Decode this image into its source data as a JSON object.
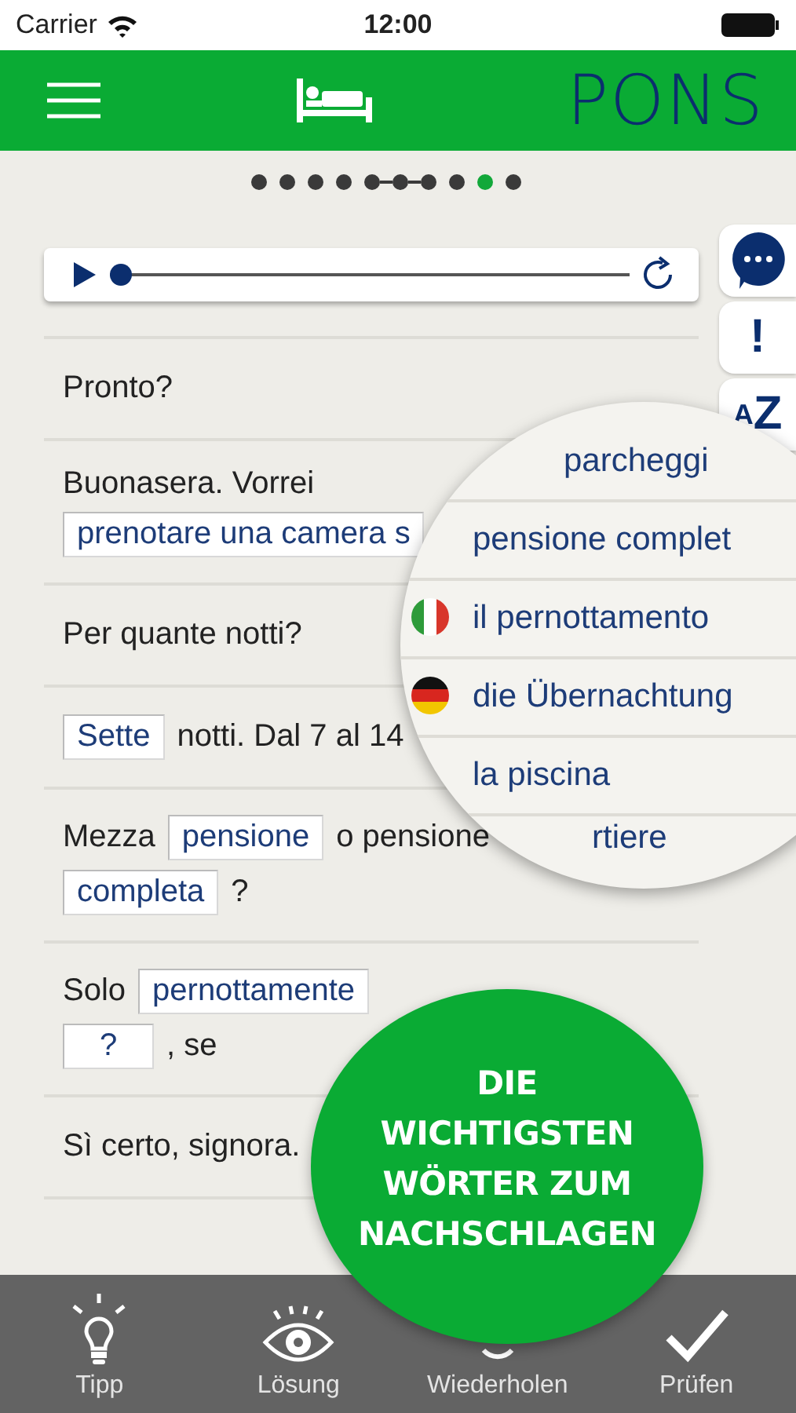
{
  "status_bar": {
    "carrier": "Carrier",
    "time": "12:00"
  },
  "header": {
    "logo": "PONS"
  },
  "page_dots": [
    {
      "selected": false,
      "linked": false
    },
    {
      "selected": false,
      "linked": false
    },
    {
      "selected": false,
      "linked": false
    },
    {
      "selected": false,
      "linked": false
    },
    {
      "selected": false,
      "linked": true
    },
    {
      "selected": false,
      "linked": true
    },
    {
      "selected": false,
      "linked": false
    },
    {
      "selected": false,
      "linked": false
    },
    {
      "selected": true,
      "linked": false
    },
    {
      "selected": false,
      "linked": false
    }
  ],
  "player": {
    "level": 0
  },
  "side_tabs": [
    {
      "kind": "chat"
    },
    {
      "kind": "text",
      "label": "!"
    },
    {
      "kind": "text",
      "label": "$^{A}$Z"
    }
  ],
  "dialogue": [
    {
      "lines": [
        [
          {
            "kind": "text",
            "text": "Pronto?"
          }
        ]
      ]
    },
    {
      "lines": [
        [
          {
            "kind": "text",
            "text": "Buonasera. Vorrei"
          }
        ],
        [
          {
            "kind": "blank",
            "text": "prenotare una camera s"
          }
        ]
      ]
    },
    {
      "lines": [
        [
          {
            "kind": "text",
            "text": "Per quante notti?"
          }
        ]
      ]
    },
    {
      "lines": [
        [
          {
            "kind": "blank",
            "text": "Sette"
          },
          {
            "kind": "text",
            "text": "notti. Dal 7 al 14"
          }
        ]
      ]
    },
    {
      "lines": [
        [
          {
            "kind": "text",
            "text": "Mezza"
          },
          {
            "kind": "blank",
            "text": "pensione"
          },
          {
            "kind": "text",
            "text": "o pensione"
          }
        ],
        [
          {
            "kind": "blank",
            "text": "completa"
          },
          {
            "kind": "text",
            "text": "?"
          }
        ]
      ]
    },
    {
      "lines": [
        [
          {
            "kind": "text",
            "text": "Solo"
          },
          {
            "kind": "blank",
            "text": "pernottamente"
          }
        ],
        [
          {
            "kind": "blank",
            "text": "?"
          },
          {
            "kind": "text",
            "text": ", se"
          }
        ]
      ]
    },
    {
      "lines": [
        [
          {
            "kind": "text",
            "text": "Sì certo, signora."
          }
        ]
      ]
    }
  ],
  "magnifier": {
    "items": [
      {
        "text": "parcheggi",
        "kind": "top"
      },
      {
        "text": "pensione complet",
        "kind": "word"
      },
      {
        "text": "il pernottamento",
        "kind": "italian"
      },
      {
        "text": "die Übernachtung",
        "kind": "german"
      },
      {
        "text": "la piscina",
        "kind": "word"
      },
      {
        "text": "rtiere",
        "kind": "cut"
      }
    ]
  },
  "promo": {
    "lines": [
      "DIE",
      "WICHTIGSTEN",
      "WÖRTER ZUM",
      "NACHSCHLAGEN"
    ]
  },
  "toolbar": [
    {
      "kind": "tip",
      "label": "Tipp"
    },
    {
      "kind": "solution",
      "label": "Lösung"
    },
    {
      "kind": "repeat",
      "label": "Wiederholen"
    },
    {
      "kind": "check",
      "label": "Prüfen"
    }
  ]
}
